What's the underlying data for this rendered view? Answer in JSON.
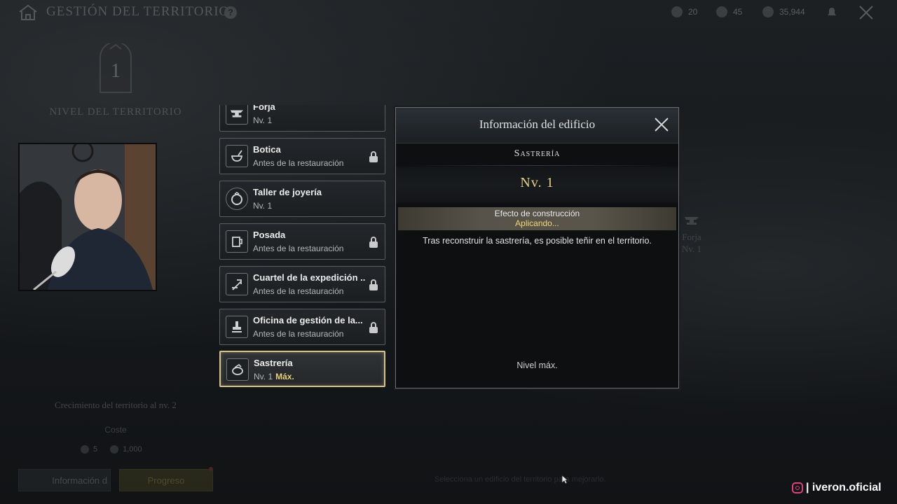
{
  "header": {
    "title": "GESTIÓN DEL TERRITORIO",
    "help_icon": "?",
    "resources": [
      {
        "icon": "coin-icon",
        "value": "20"
      },
      {
        "icon": "gem-icon",
        "value": "45"
      },
      {
        "icon": "silver-icon",
        "value": "35,944"
      }
    ]
  },
  "territory": {
    "level": "1",
    "level_label": "NIVEL DEL TERRITORIO",
    "growth_label": "Crecimiento del territorio al nv. 2",
    "cost_label": "Coste",
    "costs": [
      {
        "icon": "coin-icon",
        "value": "5"
      },
      {
        "icon": "silver-icon",
        "value": "1,000"
      }
    ],
    "info_button": "Información d",
    "progress_button": "Progreso",
    "select_hint": "Selecciona un edificio del territorio para mejorarlo."
  },
  "background_card": {
    "name": "Forja",
    "level": "Nv. 1"
  },
  "buildings": [
    {
      "name": "Forja",
      "status": "Nv. 1",
      "locked": false,
      "icon": "anvil-icon"
    },
    {
      "name": "Botica",
      "status": "Antes de la restauración",
      "locked": true,
      "icon": "mortar-icon"
    },
    {
      "name": "Taller de joyería",
      "status": "Nv. 1",
      "locked": false,
      "icon": "ring-icon"
    },
    {
      "name": "Posada",
      "status": "Antes de la restauración",
      "locked": true,
      "icon": "mug-icon"
    },
    {
      "name": "Cuartel de la expedición ...",
      "status": "Antes de la restauración",
      "locked": true,
      "icon": "banner-icon"
    },
    {
      "name": "Oficina de gestión de la...",
      "status": "Antes de la restauración",
      "locked": true,
      "icon": "stamp-icon"
    },
    {
      "name": "Sastrería",
      "status": "Nv. 1",
      "max": "Máx.",
      "locked": false,
      "selected": true,
      "icon": "sewing-icon"
    }
  ],
  "dialog": {
    "title": "Información del edificio",
    "building_name": "Sastrería",
    "level": "Nv. 1",
    "effect_title": "Efecto de construcción",
    "effect_state": "Aplicando...",
    "description": "Tras reconstruir la sastrería, es posible teñir en el territorio.",
    "max_level": "Nivel máx."
  },
  "watermark": "| iveron.oficial",
  "colors": {
    "accent_gold": "#e7cf82",
    "selected_border": "#d6c48a",
    "status_yellow": "#f0d774"
  }
}
